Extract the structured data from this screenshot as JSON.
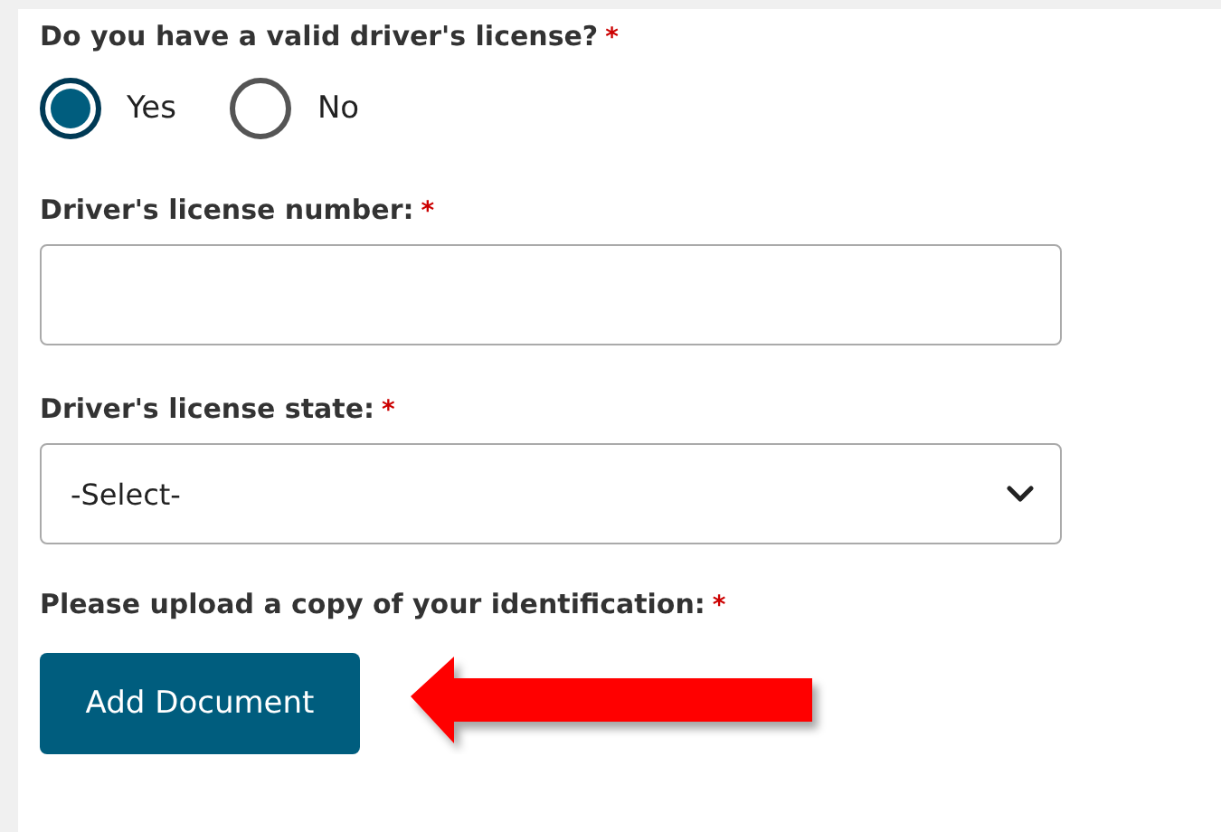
{
  "fields": [
    {
      "kind": "radio",
      "label": "Do you have a valid driver's license?",
      "required_mark": "*",
      "options": [
        {
          "label": "Yes",
          "selected": true
        },
        {
          "label": "No",
          "selected": false
        }
      ]
    },
    {
      "kind": "text",
      "label": "Driver's license number:",
      "required_mark": "*"
    },
    {
      "kind": "select",
      "label": "Driver's license state:",
      "required_mark": "*",
      "value": "-Select-"
    },
    {
      "kind": "upload",
      "label": "Please upload a copy of your identification:",
      "required_mark": "*",
      "button": "Add Document"
    }
  ]
}
